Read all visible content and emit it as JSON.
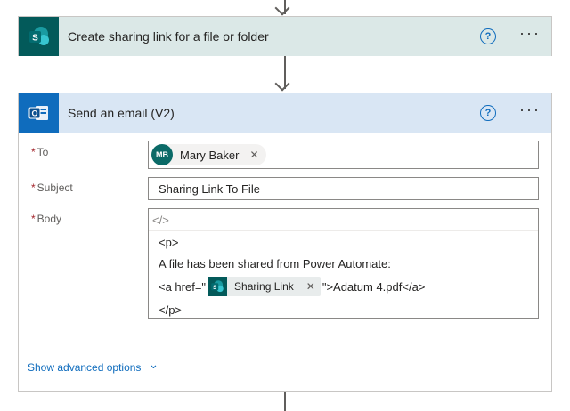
{
  "step1": {
    "title": "Create sharing link for a file or folder",
    "help_glyph": "?",
    "more_glyph": "···",
    "icon": "sharepoint-icon",
    "color": "#035a5a",
    "header_bg": "#dbe8e7"
  },
  "step2": {
    "title": "Send an email (V2)",
    "help_glyph": "?",
    "more_glyph": "···",
    "icon": "outlook-icon",
    "color": "#0f6cbd",
    "header_bg": "#d9e6f4"
  },
  "form": {
    "to": {
      "required_mark": "*",
      "label": "To",
      "recipient_initials": "MB",
      "recipient_name": "Mary Baker",
      "remove_glyph": "✕"
    },
    "subject": {
      "required_mark": "*",
      "label": "Subject",
      "value": "Sharing Link To File"
    },
    "body": {
      "required_mark": "*",
      "label": "Body",
      "code_view_glyph": "</>",
      "line1": "<p>",
      "line2": "A file has been shared from Power Automate:",
      "line3_prefix": "<a href=\"",
      "token_label": "Sharing Link",
      "token_remove": "✕",
      "line3_suffix": "\">Adatum 4.pdf</a>",
      "line4": "</p>"
    },
    "advanced": {
      "label": "Show advanced options",
      "chevron": "⌄"
    }
  }
}
